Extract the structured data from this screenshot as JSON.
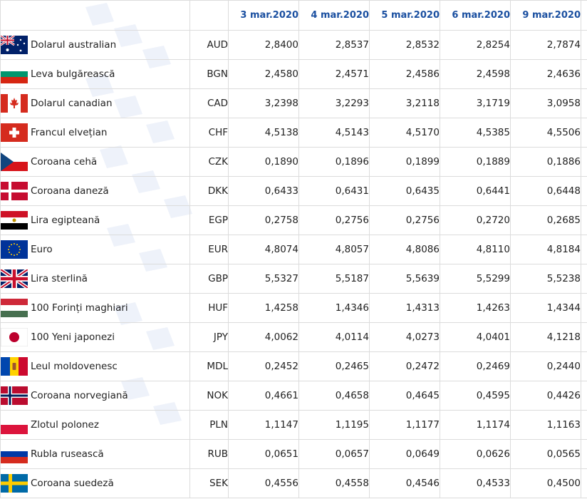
{
  "header": {
    "dates": [
      "3 mar.2020",
      "4 mar.2020",
      "5 mar.2020",
      "6 mar.2020",
      "9 mar.2020"
    ]
  },
  "rows": [
    {
      "name": "Dolarul australian",
      "code": "AUD",
      "flag_icon": "australia-flag-icon",
      "values": [
        "2,8400",
        "2,8537",
        "2,8532",
        "2,8254",
        "2,7874"
      ]
    },
    {
      "name": "Leva bulgărească",
      "code": "BGN",
      "flag_icon": "bulgaria-flag-icon",
      "values": [
        "2,4580",
        "2,4571",
        "2,4586",
        "2,4598",
        "2,4636"
      ]
    },
    {
      "name": "Dolarul canadian",
      "code": "CAD",
      "flag_icon": "canada-flag-icon",
      "values": [
        "3,2398",
        "3,2293",
        "3,2118",
        "3,1719",
        "3,0958"
      ]
    },
    {
      "name": "Francul elvețian",
      "code": "CHF",
      "flag_icon": "switzerland-flag-icon",
      "values": [
        "4,5138",
        "4,5143",
        "4,5170",
        "4,5385",
        "4,5506"
      ]
    },
    {
      "name": "Coroana cehă",
      "code": "CZK",
      "flag_icon": "czech-flag-icon",
      "values": [
        "0,1890",
        "0,1896",
        "0,1899",
        "0,1889",
        "0,1886"
      ]
    },
    {
      "name": "Coroana daneză",
      "code": "DKK",
      "flag_icon": "denmark-flag-icon",
      "values": [
        "0,6433",
        "0,6431",
        "0,6435",
        "0,6441",
        "0,6448"
      ]
    },
    {
      "name": "Lira egipteană",
      "code": "EGP",
      "flag_icon": "egypt-flag-icon",
      "values": [
        "0,2758",
        "0,2756",
        "0,2756",
        "0,2720",
        "0,2685"
      ]
    },
    {
      "name": "Euro",
      "code": "EUR",
      "flag_icon": "eu-flag-icon",
      "values": [
        "4,8074",
        "4,8057",
        "4,8086",
        "4,8110",
        "4,8184"
      ]
    },
    {
      "name": "Lira sterlină",
      "code": "GBP",
      "flag_icon": "uk-flag-icon",
      "values": [
        "5,5327",
        "5,5187",
        "5,5639",
        "5,5299",
        "5,5238"
      ]
    },
    {
      "name": "100 Forinți maghiari",
      "code": "HUF",
      "flag_icon": "hungary-flag-icon",
      "values": [
        "1,4258",
        "1,4346",
        "1,4313",
        "1,4263",
        "1,4344"
      ]
    },
    {
      "name": "100 Yeni japonezi",
      "code": "JPY",
      "flag_icon": "japan-flag-icon",
      "values": [
        "4,0062",
        "4,0114",
        "4,0273",
        "4,0401",
        "4,1218"
      ]
    },
    {
      "name": "Leul moldovenesc",
      "code": "MDL",
      "flag_icon": "moldova-flag-icon",
      "values": [
        "0,2452",
        "0,2465",
        "0,2472",
        "0,2469",
        "0,2440"
      ]
    },
    {
      "name": "Coroana norvegiană",
      "code": "NOK",
      "flag_icon": "norway-flag-icon",
      "values": [
        "0,4661",
        "0,4658",
        "0,4645",
        "0,4595",
        "0,4426"
      ]
    },
    {
      "name": "Zlotul polonez",
      "code": "PLN",
      "flag_icon": "poland-flag-icon",
      "values": [
        "1,1147",
        "1,1195",
        "1,1177",
        "1,1174",
        "1,1163"
      ]
    },
    {
      "name": "Rubla rusească",
      "code": "RUB",
      "flag_icon": "russia-flag-icon",
      "values": [
        "0,0651",
        "0,0657",
        "0,0649",
        "0,0626",
        "0,0565"
      ]
    },
    {
      "name": "Coroana suedeză",
      "code": "SEK",
      "flag_icon": "sweden-flag-icon",
      "values": [
        "0,4556",
        "0,4558",
        "0,4546",
        "0,4533",
        "0,4500"
      ]
    }
  ],
  "colors": {
    "header_text": "#1a4fa0",
    "grid_line": "#dcdcdc",
    "watermark": "#eef2fa"
  }
}
